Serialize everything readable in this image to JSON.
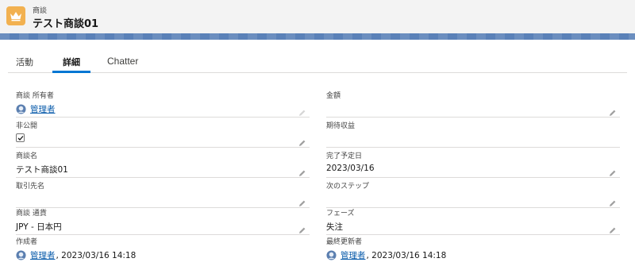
{
  "header": {
    "object_type": "商談",
    "title": "テスト商談01",
    "icon": "crown-icon",
    "icon_color": "#f2b150"
  },
  "tabs": [
    {
      "label": "活動",
      "active": false
    },
    {
      "label": "詳細",
      "active": true
    },
    {
      "label": "Chatter",
      "active": false
    }
  ],
  "fields": {
    "owner": {
      "label": "商談 所有者",
      "value": "管理者"
    },
    "amount": {
      "label": "金額",
      "value": ""
    },
    "private": {
      "label": "非公開",
      "checked": true
    },
    "expected_revenue": {
      "label": "期待収益",
      "value": ""
    },
    "name": {
      "label": "商談名",
      "value": "テスト商談01"
    },
    "close_date": {
      "label": "完了予定日",
      "value": "2023/03/16"
    },
    "account": {
      "label": "取引先名",
      "value": ""
    },
    "next_step": {
      "label": "次のステップ",
      "value": ""
    },
    "currency": {
      "label": "商談 通貨",
      "value": "JPY - 日本円"
    },
    "stage": {
      "label": "フェーズ",
      "value": "失注"
    },
    "created_by": {
      "label": "作成者",
      "user": "管理者",
      "timestamp": ", 2023/03/16 14:18"
    },
    "modified_by": {
      "label": "最終更新者",
      "user": "管理者",
      "timestamp": ", 2023/03/16 14:18"
    }
  },
  "colors": {
    "accent": "#0176d3",
    "link": "#0b5cab",
    "band": "#5a81b8"
  }
}
